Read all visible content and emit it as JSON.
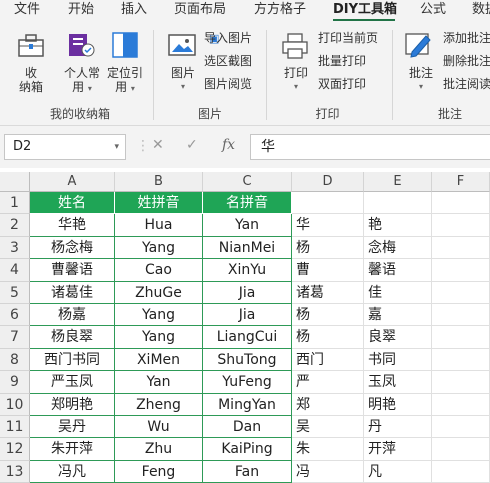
{
  "tabs": [
    "文件",
    "开始",
    "插入",
    "页面布局",
    "方方格子",
    "DIY工具箱",
    "公式",
    "数据"
  ],
  "active_tab": "DIY工具箱",
  "ribbon": {
    "groups": {
      "collection": {
        "label": "我的收纳箱",
        "collect_line1": "收",
        "collect_line2": "纳箱",
        "personal_line1": "个人常",
        "personal_line2": "用",
        "locate_line1": "定位引",
        "locate_line2": "用"
      },
      "image": {
        "label": "图片",
        "image_btn": "图片",
        "import": "导入图片",
        "capture": "选区截图",
        "browse": "图片阅览"
      },
      "print": {
        "label": "打印",
        "print_btn": "打印",
        "print_page": "打印当前页",
        "batch": "批量打印",
        "duplex": "双面打印"
      },
      "comment": {
        "label": "批注",
        "comment_btn": "批注",
        "add": "添加批注",
        "delete": "删除批注",
        "read": "批注阅读"
      }
    }
  },
  "formula_bar": {
    "name_box": "D2",
    "fx": "fx",
    "value": "华"
  },
  "columns": [
    "A",
    "B",
    "C",
    "D",
    "E",
    "F"
  ],
  "rows": [
    [
      "姓名",
      "姓拼音",
      "名拼音",
      "",
      "",
      ""
    ],
    [
      "华艳",
      "Hua",
      "Yan",
      "华",
      "艳",
      ""
    ],
    [
      "杨念梅",
      "Yang",
      "NianMei",
      "杨",
      "念梅",
      ""
    ],
    [
      "曹馨语",
      "Cao",
      "XinYu",
      "曹",
      "馨语",
      ""
    ],
    [
      "诸葛佳",
      "ZhuGe",
      "Jia",
      "诸葛",
      "佳",
      ""
    ],
    [
      "杨嘉",
      "Yang",
      "Jia",
      "杨",
      "嘉",
      ""
    ],
    [
      "杨良翠",
      "Yang",
      "LiangCui",
      "杨",
      "良翠",
      ""
    ],
    [
      "西门书同",
      "XiMen",
      "ShuTong",
      "西门",
      "书同",
      ""
    ],
    [
      "严玉凤",
      "Yan",
      "YuFeng",
      "严",
      "玉凤",
      ""
    ],
    [
      "郑明艳",
      "Zheng",
      "MingYan",
      "郑",
      "明艳",
      ""
    ],
    [
      "吴丹",
      "Wu",
      "Dan",
      "吴",
      "丹",
      ""
    ],
    [
      "朱开萍",
      "Zhu",
      "KaiPing",
      "朱",
      "开萍",
      ""
    ],
    [
      "冯凡",
      "Feng",
      "Fan",
      "冯",
      "凡",
      ""
    ]
  ],
  "row_numbers": [
    "1",
    "2",
    "3",
    "4",
    "5",
    "6",
    "7",
    "8",
    "9",
    "10",
    "11",
    "12",
    "13"
  ],
  "colors": {
    "accent": "#217346",
    "table_header": "#1fa556",
    "table_border": "#2e9a57"
  }
}
